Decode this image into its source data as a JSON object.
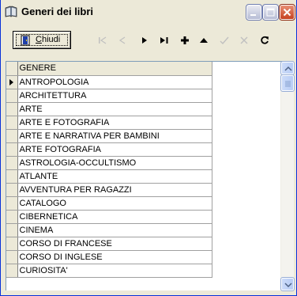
{
  "window": {
    "title": "Generi dei libri",
    "icon": "book-icon"
  },
  "toolbar": {
    "close_label_access_key": "C",
    "close_label_rest": "hiudi",
    "icons": [
      "first-record-icon",
      "previous-record-icon",
      "next-record-icon",
      "last-record-icon",
      "add-record-icon",
      "delete-record-icon",
      "confirm-edit-icon",
      "cancel-edit-icon",
      "refresh-icon"
    ]
  },
  "grid": {
    "column_header": "GENERE",
    "current_row": 0,
    "rows": [
      "ANTROPOLOGIA",
      "ARCHITETTURA",
      "ARTE",
      "ARTE E FOTOGRAFIA",
      "ARTE E NARRATIVA PER BAMBINI",
      "ARTE FOTOGRAFIA",
      "ASTROLOGIA-OCCULTISMO",
      "ATLANTE",
      "AVVENTURA PER RAGAZZI",
      "CATALOGO",
      "CIBERNETICA",
      "CINEMA",
      "CORSO DI FRANCESE",
      "CORSO DI INGLESE",
      "CURIOSITA'"
    ]
  },
  "colors": {
    "window_background": "#ece9d8",
    "grid_lines": "#a0a0a0",
    "close_button": "#c64221"
  }
}
